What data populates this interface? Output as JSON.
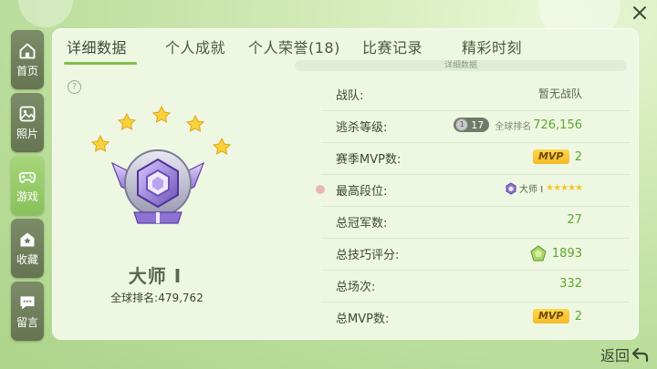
{
  "sidebar": {
    "items": [
      {
        "label": "首页",
        "icon": "home-icon",
        "active": false
      },
      {
        "label": "照片",
        "icon": "photo-icon",
        "active": false
      },
      {
        "label": "游戏",
        "icon": "gamepad-icon",
        "active": true
      },
      {
        "label": "收藏",
        "icon": "star-house-icon",
        "active": false
      },
      {
        "label": "留言",
        "icon": "message-icon",
        "active": false
      }
    ]
  },
  "tabs": [
    {
      "label": "详细数据",
      "active": true
    },
    {
      "label": "个人成就",
      "active": false
    },
    {
      "label": "个人荣誉(18)",
      "active": false
    },
    {
      "label": "比赛记录",
      "active": false
    },
    {
      "label": "精彩时刻",
      "active": false
    }
  ],
  "section_label": "详细数据",
  "rank": {
    "name": "大师 I",
    "global_rank_label": "全球排名:",
    "global_rank_value": "479,762",
    "star_count": 5
  },
  "stats": {
    "team": {
      "label": "战队:",
      "value": "暂无战队"
    },
    "escape_level": {
      "label": "逃杀等级:",
      "level": "17",
      "coin": "1",
      "rank_label": "全球排名",
      "rank_value": "726,156"
    },
    "season_mvp": {
      "label": "赛季MVP数:",
      "tag": "MVP",
      "value": "2"
    },
    "highest_tier": {
      "label": "最高段位:",
      "tier_name": "大师 I",
      "stars": "★★★★★"
    },
    "total_championships": {
      "label": "总冠军数:",
      "value": "27"
    },
    "total_skill_score": {
      "label": "总技巧评分:",
      "value": "1893"
    },
    "total_matches": {
      "label": "总场次:",
      "value": "332"
    },
    "total_mvp": {
      "label": "总MVP数:",
      "tag": "MVP",
      "value": "2"
    }
  },
  "footer": {
    "back_label": "返回"
  },
  "colors": {
    "accent_green": "#7fbf4d",
    "value_green": "#5ea72e",
    "sidebar_dark": "#6e7c5a",
    "mvp_gold": "#f5b926",
    "badge_purple": "#8e78c9"
  }
}
